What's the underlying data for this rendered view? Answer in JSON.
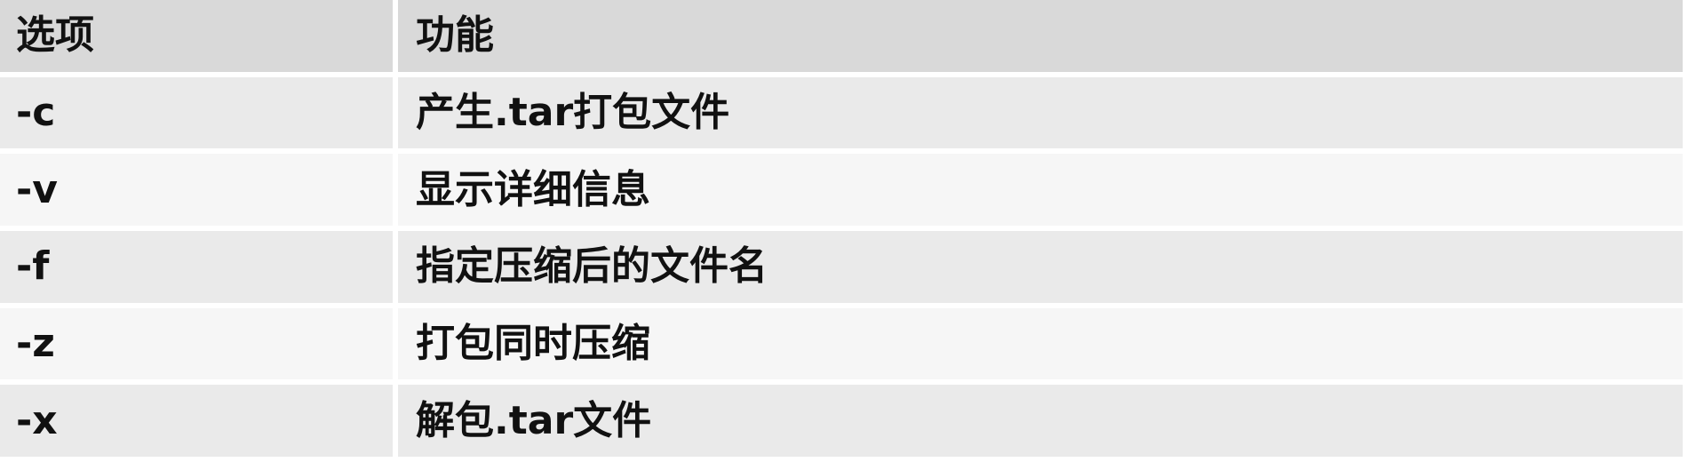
{
  "table": {
    "headers": [
      "选项",
      "功能"
    ],
    "rows": [
      [
        "-c",
        "产生.tar打包文件"
      ],
      [
        "-v",
        "显示详细信息"
      ],
      [
        "-f",
        "指定压缩后的文件名"
      ],
      [
        "-z",
        "打包同时压缩"
      ],
      [
        "-x",
        "解包.tar文件"
      ]
    ]
  },
  "colors": {
    "header_bg": "#d9d9d9",
    "row_odd_bg": "#eaeaea",
    "row_even_bg": "#f6f6f6",
    "text": "#111111",
    "grid_line": "#ffffff"
  }
}
